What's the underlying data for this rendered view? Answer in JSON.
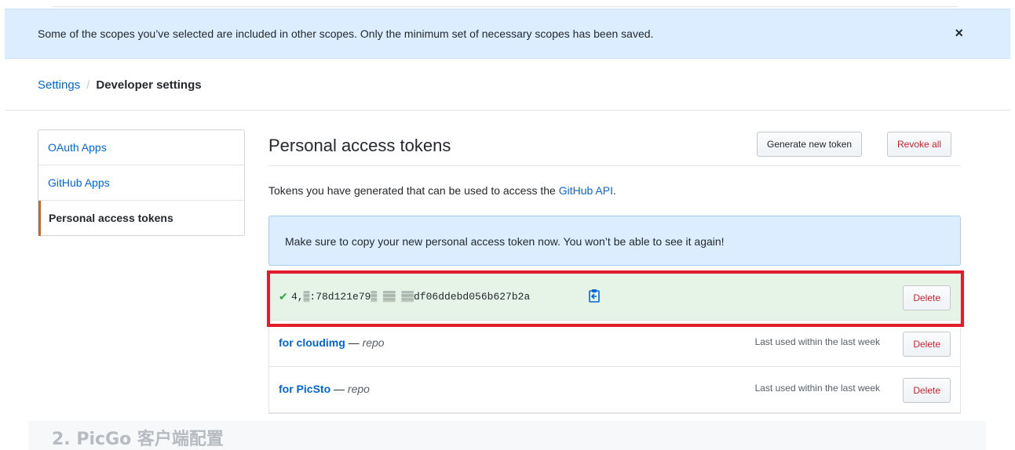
{
  "flash": {
    "message": "Some of the scopes you’ve selected are included in other scopes. Only the minimum set of necessary scopes has been saved.",
    "close_glyph": "×"
  },
  "breadcrumb": {
    "parent": "Settings",
    "separator": "/",
    "current": "Developer settings"
  },
  "sidebar": {
    "items": [
      {
        "label": "OAuth Apps"
      },
      {
        "label": "GitHub Apps"
      },
      {
        "label": "Personal access tokens"
      }
    ]
  },
  "main": {
    "title": "Personal access tokens",
    "generate_label": "Generate new token",
    "revoke_label": "Revoke all",
    "lead_text": "Tokens you have generated that can be used to access the ",
    "lead_link": "GitHub API",
    "lead_end": "."
  },
  "notice": {
    "text": "Make sure to copy your new personal access token now. You won’t be able to see it again!"
  },
  "tokens": {
    "new_token": {
      "value": "4,▒:78d121e79▒ ▒▒ ▒▒df06ddebd056b627b2a",
      "delete_label": "Delete"
    },
    "rows": [
      {
        "name": "for cloudimg",
        "dash": " — ",
        "scope": "repo",
        "last_used": "Last used within the last week",
        "delete_label": "Delete"
      },
      {
        "name": "for PicSto",
        "dash": " — ",
        "scope": "repo",
        "last_used": "Last used within the last week",
        "delete_label": "Delete"
      }
    ]
  },
  "footer": {
    "title": "2. PicGo 客户端配置"
  },
  "colors": {
    "link": "#0366d6",
    "danger": "#cb2431",
    "highlight": "#e21d2b",
    "flash_bg": "#dbedff",
    "success_bg": "#e6f4e8"
  },
  "icons": [
    "close-icon",
    "check-icon",
    "clipboard-icon"
  ]
}
